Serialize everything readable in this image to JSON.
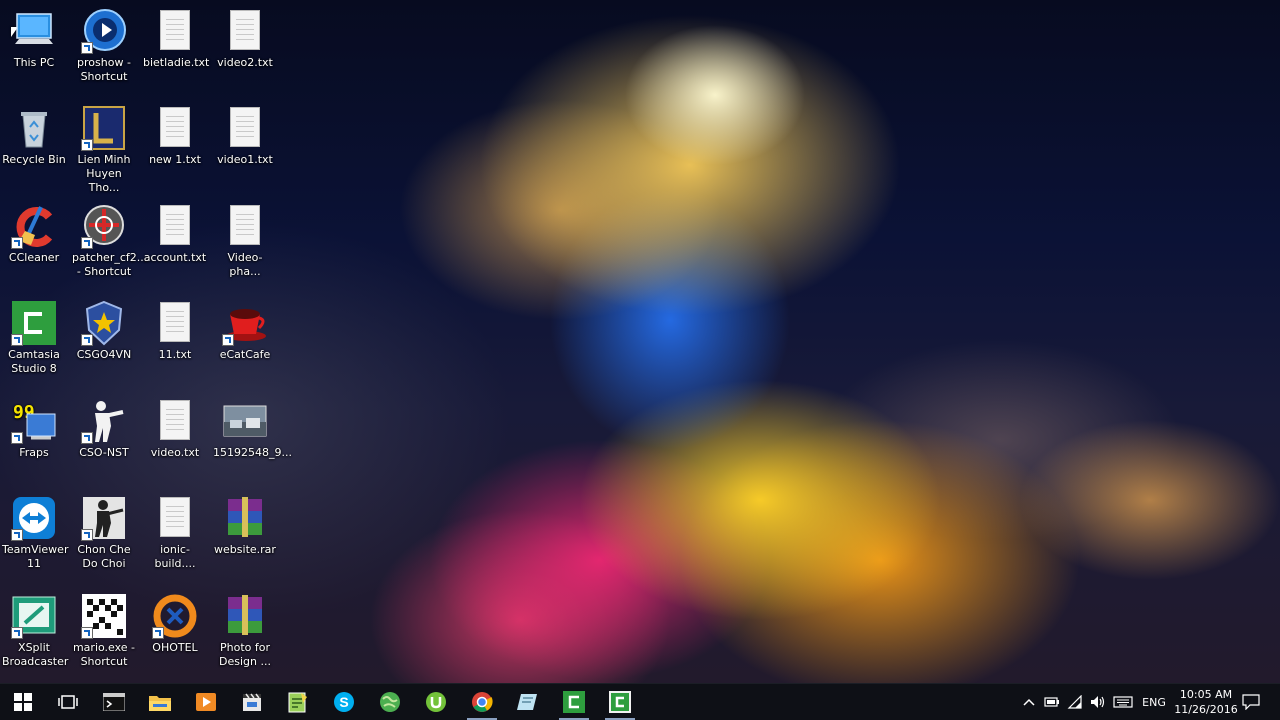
{
  "desktop": {
    "icons": [
      {
        "label": "This PC",
        "icon": "computer-icon"
      },
      {
        "label": "Recycle Bin",
        "icon": "recycle-bin-icon"
      },
      {
        "label": "CCleaner",
        "icon": "ccleaner-icon"
      },
      {
        "label": "Camtasia Studio 8",
        "icon": "camtasia-icon"
      },
      {
        "label": "Fraps",
        "icon": "fraps-icon"
      },
      {
        "label": "TeamViewer 11",
        "icon": "teamviewer-icon"
      },
      {
        "label": "XSplit Broadcaster",
        "icon": "xsplit-icon"
      },
      {
        "label": "proshow - Shortcut",
        "icon": "proshow-icon"
      },
      {
        "label": "Lien Minh Huyen Tho...",
        "icon": "lol-icon"
      },
      {
        "label": "patcher_cf2... - Shortcut",
        "icon": "crossfire-icon"
      },
      {
        "label": "CSGO4VN",
        "icon": "csgo-shield-icon"
      },
      {
        "label": "CSO-NST",
        "icon": "soldier-icon"
      },
      {
        "label": "Chon Che Do Choi",
        "icon": "counter-strike-icon"
      },
      {
        "label": "mario.exe - Shortcut",
        "icon": "mario-icon"
      },
      {
        "label": "bietladie.txt",
        "icon": "text-file-icon"
      },
      {
        "label": "new 1.txt",
        "icon": "text-file-icon"
      },
      {
        "label": "account.txt",
        "icon": "text-file-icon"
      },
      {
        "label": "11.txt",
        "icon": "text-file-icon"
      },
      {
        "label": "video.txt",
        "icon": "text-file-icon"
      },
      {
        "label": "ionic-build....",
        "icon": "text-file-icon"
      },
      {
        "label": "OHOTEL",
        "icon": "ohotel-icon"
      },
      {
        "label": "video2.txt",
        "icon": "text-file-icon"
      },
      {
        "label": "video1.txt",
        "icon": "text-file-icon"
      },
      {
        "label": "Video-pha...",
        "icon": "text-file-icon"
      },
      {
        "label": "eCatCafe",
        "icon": "coffee-cup-icon"
      },
      {
        "label": "15192548_9...",
        "icon": "image-thumbnail-icon"
      },
      {
        "label": "website.rar",
        "icon": "winrar-archive-icon"
      },
      {
        "label": "Photo for Design ...",
        "icon": "winrar-archive-icon"
      }
    ]
  },
  "taskbar": {
    "apps": [
      {
        "icon": "windows-start-icon"
      },
      {
        "icon": "task-view-icon"
      },
      {
        "icon": "command-prompt-icon"
      },
      {
        "icon": "file-explorer-icon"
      },
      {
        "icon": "media-player-icon"
      },
      {
        "icon": "movie-maker-icon"
      },
      {
        "icon": "notepad-plus-plus-icon"
      },
      {
        "icon": "skype-icon"
      },
      {
        "icon": "globe-icon"
      },
      {
        "icon": "utorrent-icon"
      },
      {
        "icon": "chrome-icon"
      },
      {
        "icon": "document-app-icon"
      },
      {
        "icon": "camtasia-icon"
      },
      {
        "icon": "camtasia-recorder-icon"
      }
    ],
    "tray": {
      "language": "ENG",
      "time": "10:05 AM",
      "date": "11/26/2016"
    }
  },
  "colors": {
    "taskbar_bg": "#0e1016",
    "camtasia_green": "#2e9e3e",
    "skype_blue": "#00aff0"
  }
}
